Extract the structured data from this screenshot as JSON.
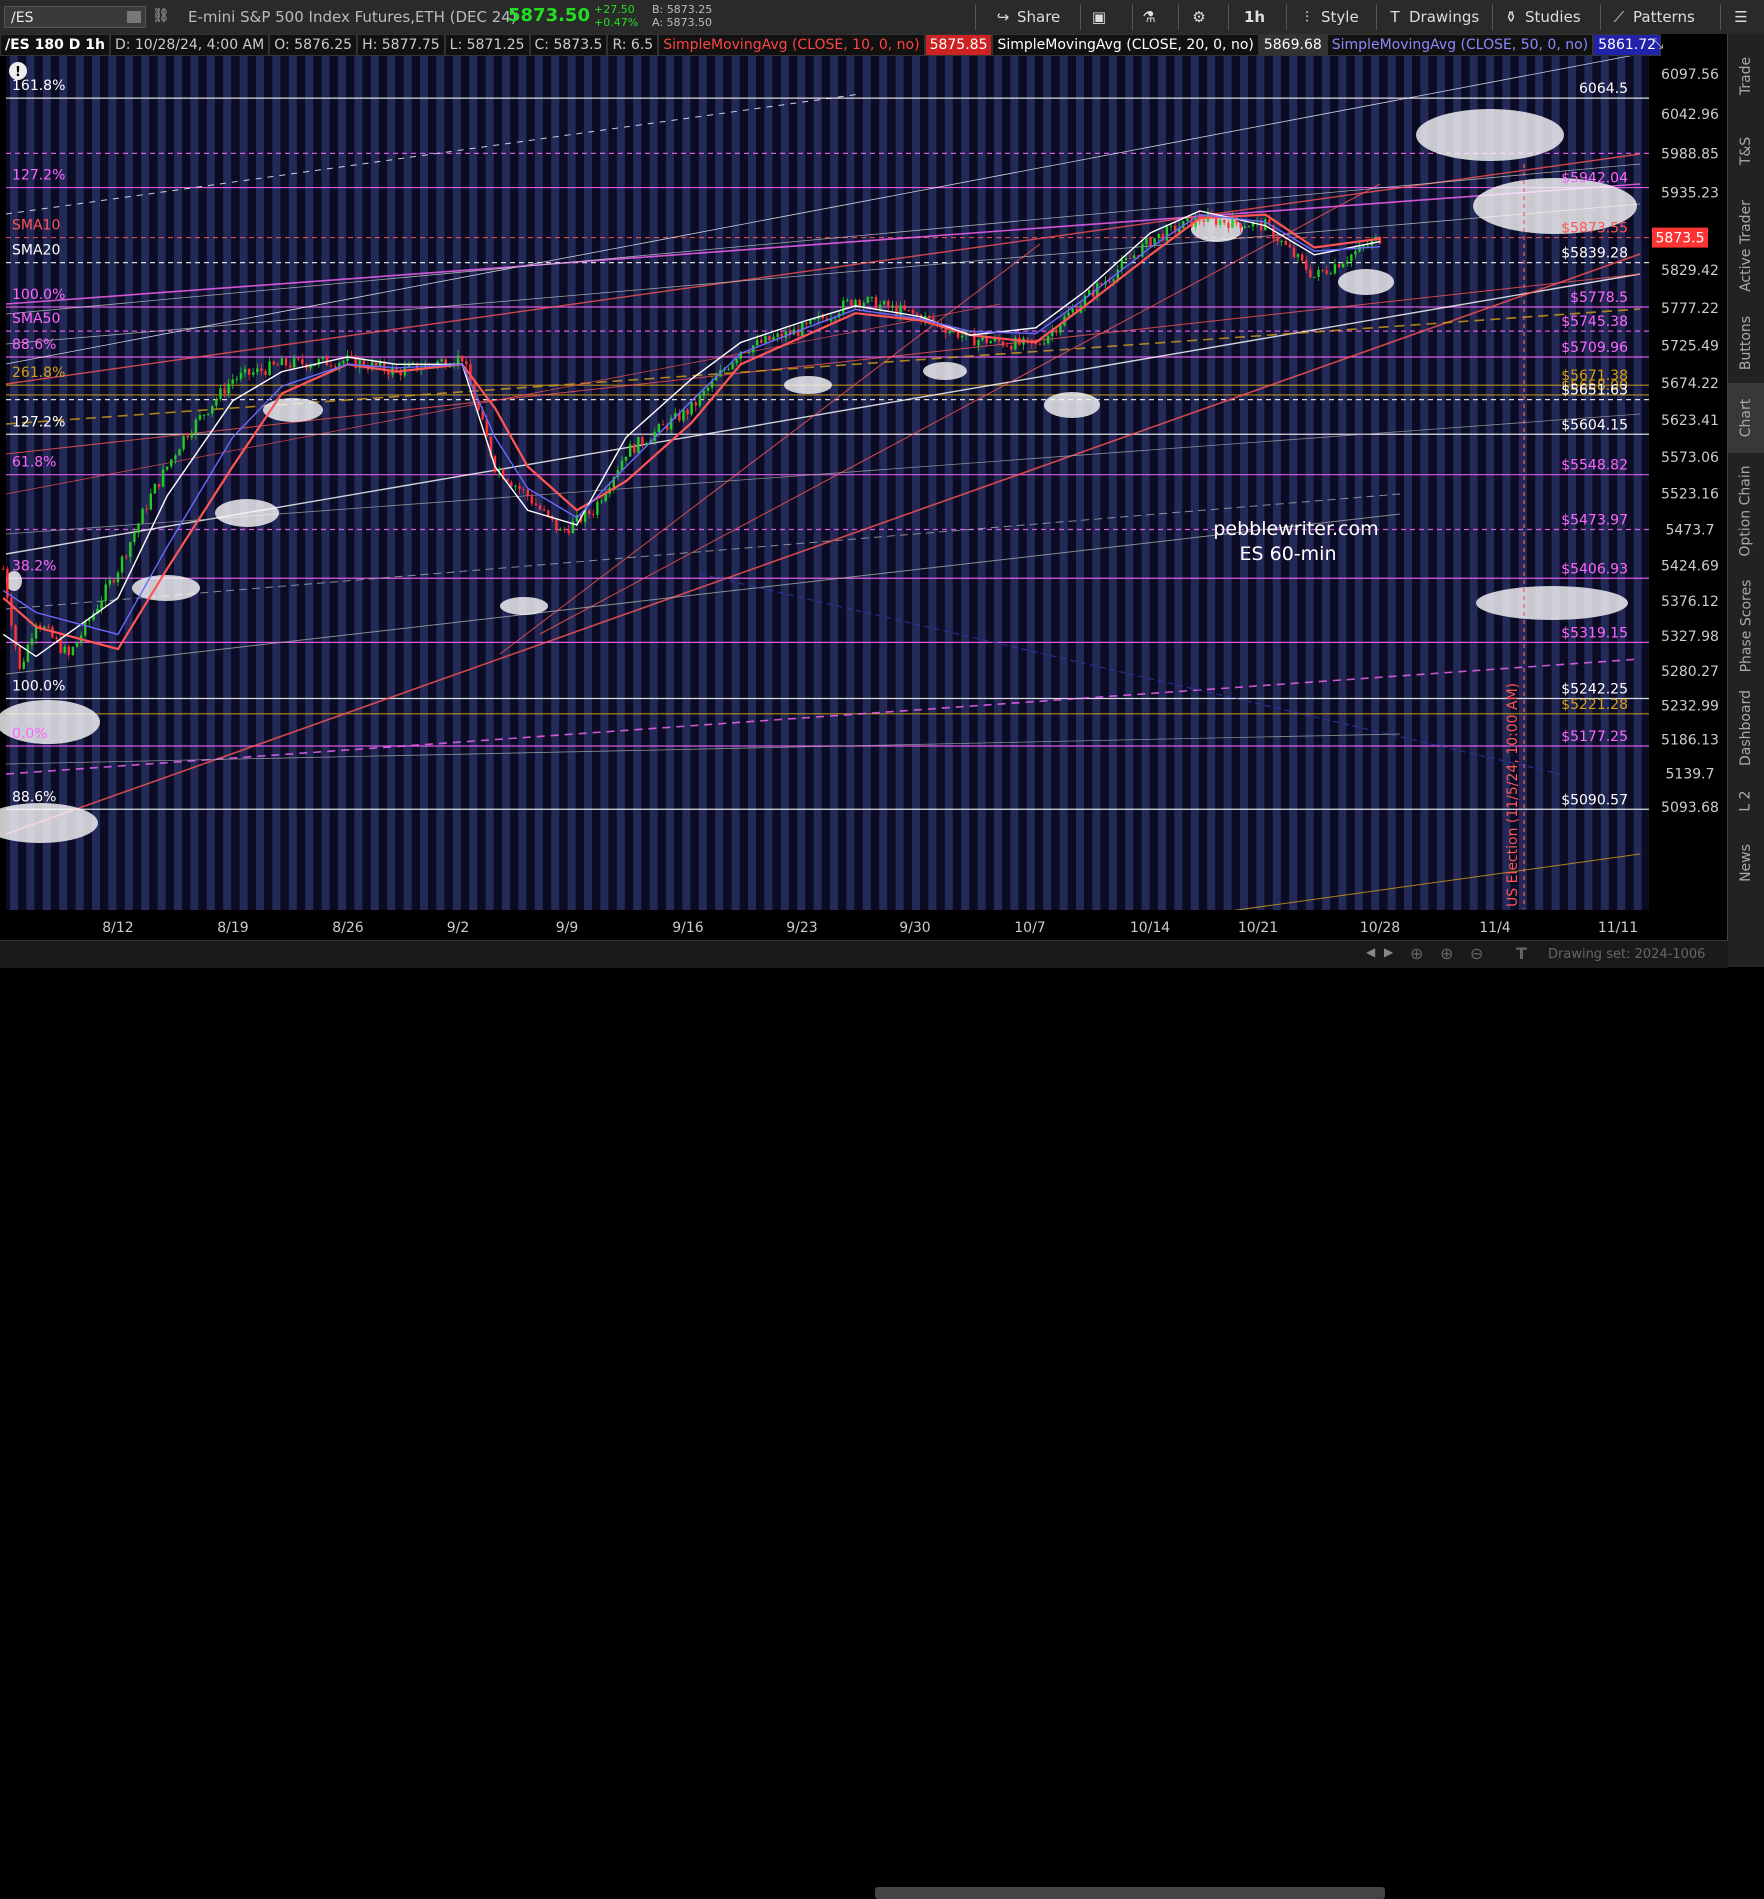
{
  "toolbar": {
    "symbol": "/ES",
    "instrument": "E-mini S&P 500 Index Futures,ETH (DEC 24)",
    "last": "5873.50",
    "change_abs": "+27.50",
    "change_pct": "+0.47%",
    "bid": "B: 5873.25",
    "ask": "A: 5873.50",
    "share": "Share",
    "interval": "1h",
    "style": "Style",
    "drawings": "Drawings",
    "studies": "Studies",
    "patterns": "Patterns"
  },
  "studybar": {
    "header": "/ES 180 D 1h",
    "date": "D: 10/28/24, 4:00 AM",
    "open": "O: 5876.25",
    "high": "H: 5877.75",
    "low": "L: 5871.25",
    "close": "C: 5873.5",
    "range": "R: 6.5",
    "sma10_label": "SimpleMovingAvg (CLOSE, 10, 0, no)",
    "sma10_value": "5875.85",
    "sma20_label": "SimpleMovingAvg (CLOSE, 20, 0, no)",
    "sma20_value": "5869.68",
    "sma50_label": "SimpleMovingAvg (CLOSE, 50, 0, no)",
    "sma50_value": "5861.72"
  },
  "sidebar": {
    "tabs": [
      "Trade",
      "T&S",
      "Active Trader",
      "Buttons",
      "Chart",
      "Option Chain",
      "Phase Scores",
      "Dashboard",
      "L 2",
      "News"
    ],
    "active": "Chart"
  },
  "bottombar": {
    "drawing_set": "Drawing set: 2024-1006"
  },
  "colors": {
    "background": "#0b0b24",
    "band": "#242a58",
    "fib": "#ff66ff",
    "sma10": "#ff5555",
    "sma20": "#ffffff",
    "sma50": "#6a6aff",
    "gold": "#d4a017",
    "up": "#22cc22",
    "down": "#ff3333"
  },
  "chart_data": {
    "type": "line",
    "y_axis": {
      "range": [
        5093.68,
        6097.56
      ],
      "ticks": [
        6097.56,
        6042.96,
        5988.85,
        5935.23,
        5829.42,
        5777.22,
        5725.49,
        5674.22,
        5623.41,
        5573.06,
        5523.16,
        5473.7,
        5424.69,
        5376.12,
        5327.98,
        5280.27,
        5232.99,
        5186.13,
        5139.7,
        5093.68
      ]
    },
    "x_axis": {
      "ticks": [
        "8/12",
        "8/19",
        "8/26",
        "9/2",
        "9/9",
        "9/16",
        "9/23",
        "9/30",
        "10/7",
        "10/14",
        "10/21",
        "10/28",
        "11/4",
        "11/11"
      ]
    },
    "current_price": "5873.5",
    "watermark": [
      "pebblewriter.com",
      "ES 60-min"
    ],
    "event_label": "US Election (11/5/24, 10:00 AM)",
    "left_labels": [
      {
        "text": "161.8%",
        "y": 6064.5,
        "color": "#ffffff"
      },
      {
        "text": "127.2%",
        "y": 5942.04,
        "color": "#ff66ff"
      },
      {
        "text": "SMA10",
        "y": 5873.55,
        "color": "#ff5555"
      },
      {
        "text": "SMA20",
        "y": 5839.28,
        "color": "#ffffff"
      },
      {
        "text": "100.0%",
        "y": 5778.5,
        "color": "#ff66ff"
      },
      {
        "text": "SMA50",
        "y": 5745.38,
        "color": "#ff66ff"
      },
      {
        "text": "88.6%",
        "y": 5709.96,
        "color": "#ff66ff"
      },
      {
        "text": "261.8%",
        "y": 5671.38,
        "color": "#d4a017"
      },
      {
        "text": "127.2%",
        "y": 5604.15,
        "color": "#ffffff"
      },
      {
        "text": "61.8%",
        "y": 5548.82,
        "color": "#ff66ff"
      },
      {
        "text": "38.2%",
        "y": 5406.93,
        "color": "#ff66ff"
      },
      {
        "text": "100.0%",
        "y": 5242.25,
        "color": "#ffffff"
      },
      {
        "text": "0.0%",
        "y": 5177.25,
        "color": "#ff66ff"
      },
      {
        "text": "88.6%",
        "y": 5090.57,
        "color": "#ffffff"
      }
    ],
    "levels": [
      {
        "value": 6064.5,
        "label": "6064.5",
        "color": "#ffffff",
        "dash": false
      },
      {
        "value": 5988.85,
        "label": "",
        "color": "#ff66ff",
        "dash": true
      },
      {
        "value": 5942.04,
        "label": "$5942.04",
        "color": "#ff66ff",
        "dash": false
      },
      {
        "value": 5873.55,
        "label": "$5873.55",
        "color": "#ff5555",
        "dash": true
      },
      {
        "value": 5839.28,
        "label": "$5839.28",
        "color": "#ffffff",
        "dash": true
      },
      {
        "value": 5778.5,
        "label": "$5778.5",
        "color": "#ff66ff",
        "dash": false
      },
      {
        "value": 5745.38,
        "label": "$5745.38",
        "color": "#ff66ff",
        "dash": true
      },
      {
        "value": 5709.96,
        "label": "$5709.96",
        "color": "#ff66ff",
        "dash": false
      },
      {
        "value": 5671.38,
        "label": "$5671.38",
        "color": "#d4a017",
        "dash": false
      },
      {
        "value": 5658.0,
        "label": "$5658.00",
        "color": "#d4a017",
        "dash": false
      },
      {
        "value": 5651.63,
        "label": "$5651.63",
        "color": "#ffffff",
        "dash": true
      },
      {
        "value": 5604.15,
        "label": "$5604.15",
        "color": "#ffffff",
        "dash": false
      },
      {
        "value": 5548.82,
        "label": "$5548.82",
        "color": "#ff66ff",
        "dash": false
      },
      {
        "value": 5473.7,
        "label": "$5473.97",
        "color": "#ff66ff",
        "dash": true
      },
      {
        "value": 5406.93,
        "label": "$5406.93",
        "color": "#ff66ff",
        "dash": false
      },
      {
        "value": 5319.15,
        "label": "$5319.15",
        "color": "#ff66ff",
        "dash": false
      },
      {
        "value": 5242.25,
        "label": "$5242.25",
        "color": "#ffffff",
        "dash": false
      },
      {
        "value": 5221.28,
        "label": "$5221.28",
        "color": "#d4a017",
        "dash": false
      },
      {
        "value": 5177.25,
        "label": "$5177.25",
        "color": "#ff66ff",
        "dash": false
      },
      {
        "value": 5090.57,
        "label": "$5090.57",
        "color": "#ffffff",
        "dash": false
      }
    ],
    "series": [
      {
        "name": "SMA10",
        "color": "#ff5555",
        "x": [
          "8/5",
          "8/7",
          "8/12",
          "8/15",
          "8/19",
          "8/22",
          "8/26",
          "8/29",
          "9/2",
          "9/4",
          "9/6",
          "9/9",
          "9/12",
          "9/16",
          "9/19",
          "9/23",
          "9/26",
          "9/30",
          "10/3",
          "10/7",
          "10/10",
          "10/14",
          "10/17",
          "10/21",
          "10/24",
          "10/28"
        ],
        "values": [
          5380,
          5340,
          5310,
          5420,
          5560,
          5660,
          5700,
          5690,
          5700,
          5640,
          5560,
          5500,
          5540,
          5620,
          5700,
          5740,
          5770,
          5760,
          5740,
          5730,
          5780,
          5850,
          5900,
          5905,
          5860,
          5872
        ]
      },
      {
        "name": "SMA20",
        "color": "#ffffff",
        "x": [
          "8/5",
          "8/7",
          "8/12",
          "8/15",
          "8/19",
          "8/22",
          "8/26",
          "8/29",
          "9/2",
          "9/4",
          "9/6",
          "9/9",
          "9/12",
          "9/16",
          "9/19",
          "9/23",
          "9/26",
          "9/30",
          "10/3",
          "10/7",
          "10/10",
          "10/14",
          "10/17",
          "10/21",
          "10/24",
          "10/28"
        ],
        "values": [
          5330,
          5300,
          5380,
          5520,
          5650,
          5690,
          5710,
          5700,
          5700,
          5560,
          5500,
          5480,
          5600,
          5680,
          5730,
          5760,
          5780,
          5765,
          5740,
          5750,
          5800,
          5880,
          5910,
          5890,
          5850,
          5868
        ]
      },
      {
        "name": "SMA50",
        "color": "#6a6aff",
        "x": [
          "8/5",
          "8/7",
          "8/12",
          "8/15",
          "8/19",
          "8/22",
          "8/26",
          "8/29",
          "9/2",
          "9/4",
          "9/6",
          "9/9",
          "9/12",
          "9/16",
          "9/19",
          "9/23",
          "9/26",
          "9/30",
          "10/3",
          "10/7",
          "10/10",
          "10/14",
          "10/17",
          "10/21",
          "10/24",
          "10/28"
        ],
        "values": [
          5390,
          5360,
          5330,
          5450,
          5600,
          5670,
          5700,
          5695,
          5700,
          5600,
          5530,
          5490,
          5560,
          5650,
          5715,
          5750,
          5775,
          5762,
          5745,
          5742,
          5790,
          5860,
          5905,
          5895,
          5855,
          5861
        ]
      }
    ]
  }
}
